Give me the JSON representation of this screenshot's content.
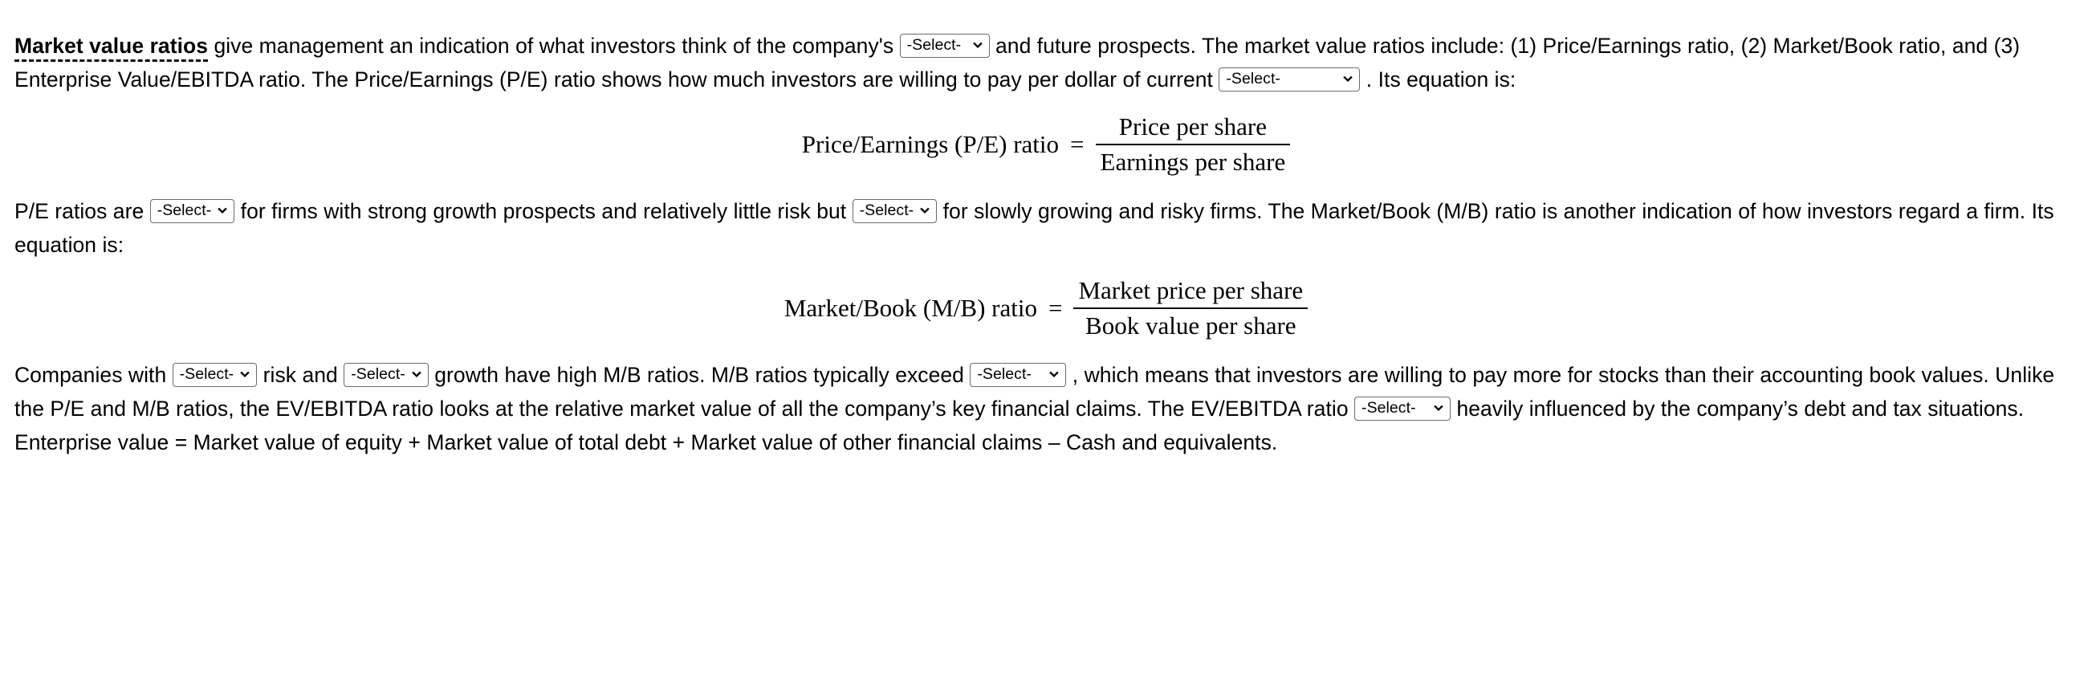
{
  "document": {
    "paragraph1": {
      "term": "Market value ratios",
      "text_a": " give management an indication of what investors think of the company's ",
      "text_b": " and future prospects. The market value ratios include: (1) Price/Earnings ratio, (2) Market/Book ratio, and (3) Enterprise Value/EBITDA ratio. The Price/Earnings (P/E) ratio shows how much investors are willing to pay per dollar of current ",
      "text_c": " . Its equation is:"
    },
    "formula1": {
      "lhs": "Price/Earnings (P/E) ratio",
      "equals": "=",
      "numerator": "Price per share",
      "denominator": "Earnings per share"
    },
    "paragraph2": {
      "text_a": "P/E ratios are ",
      "text_b": " for firms with strong growth prospects and relatively little risk but ",
      "text_c": " for slowly growing and risky firms. The Market/Book (M/B) ratio is another indication of how investors regard a firm. Its equation is:"
    },
    "formula2": {
      "lhs": "Market/Book (M/B) ratio",
      "equals": "=",
      "numerator": "Market price per share",
      "denominator": "Book value per share"
    },
    "paragraph3": {
      "text_a": "Companies with ",
      "text_b": " risk and ",
      "text_c": " growth have high M/B ratios. M/B ratios typically exceed ",
      "text_d": " , which means that investors are willing to pay more for stocks than their accounting book values. Unlike the P/E and M/B ratios, the EV/EBITDA ratio looks at the relative market value of all the company’s key financial claims. The EV/EBITDA ratio ",
      "text_e": " heavily influenced by the company’s debt and tax situations."
    },
    "paragraph4": {
      "text": "Enterprise value = Market value of equity + Market value of total debt + Market value of other financial claims – Cash and equivalents."
    },
    "selects": {
      "company_outlook": {
        "value": "-Select-",
        "placeholder": "-Select-"
      },
      "current_earnings": {
        "value": "-Select-",
        "placeholder": "-Select-"
      },
      "pe_high_low": {
        "value": "-Select-",
        "placeholder": "-Select-"
      },
      "pe_low_high": {
        "value": "-Select-",
        "placeholder": "-Select-"
      },
      "risk_level": {
        "value": "-Select-",
        "placeholder": "-Select-"
      },
      "growth_level": {
        "value": "-Select-",
        "placeholder": "-Select-"
      },
      "mb_threshold": {
        "value": "-Select-",
        "placeholder": "-Select-"
      },
      "ev_ebitda_influence": {
        "value": "-Select-",
        "placeholder": "-Select-"
      }
    },
    "colors": {
      "text": "#000000",
      "background": "#ffffff",
      "select_border": "#6b6b6b"
    }
  }
}
